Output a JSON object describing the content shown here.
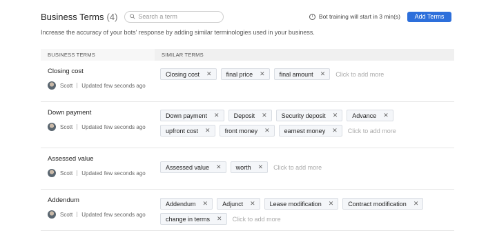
{
  "header": {
    "title": "Business Terms",
    "count": "(4)",
    "search_placeholder": "Search a term",
    "notice": "Bot training will start in 3 min(s)",
    "add_button": "Add Terms"
  },
  "description": "Increase the accuracy of your bots' response by adding similar terminologies used in your business.",
  "columns": {
    "terms": "BUSINESS TERMS",
    "similar": "SIMILAR TERMS"
  },
  "add_more_label": "Click to add more",
  "rows": [
    {
      "term": "Closing cost",
      "author": "Scott",
      "updated": "Updated few seconds ago",
      "similar": [
        "Closing cost",
        "final price",
        "final amount"
      ]
    },
    {
      "term": "Down payment",
      "author": "Scott",
      "updated": "Updated few seconds ago",
      "similar": [
        "Down payment",
        "Deposit",
        "Security deposit",
        "Advance",
        "upfront cost",
        "front money",
        "earnest money"
      ]
    },
    {
      "term": "Assessed value",
      "author": "Scott",
      "updated": "Updated few seconds ago",
      "similar": [
        "Assessed value",
        "worth"
      ]
    },
    {
      "term": "Addendum",
      "author": "Scott",
      "updated": "Updated few seconds ago",
      "similar": [
        "Addendum",
        "Adjunct",
        "Lease modification",
        "Contract modification",
        "change in terms"
      ]
    }
  ],
  "icons": {
    "search": "search-icon",
    "info": "info-icon",
    "remove": "close-icon",
    "avatar": "avatar"
  }
}
